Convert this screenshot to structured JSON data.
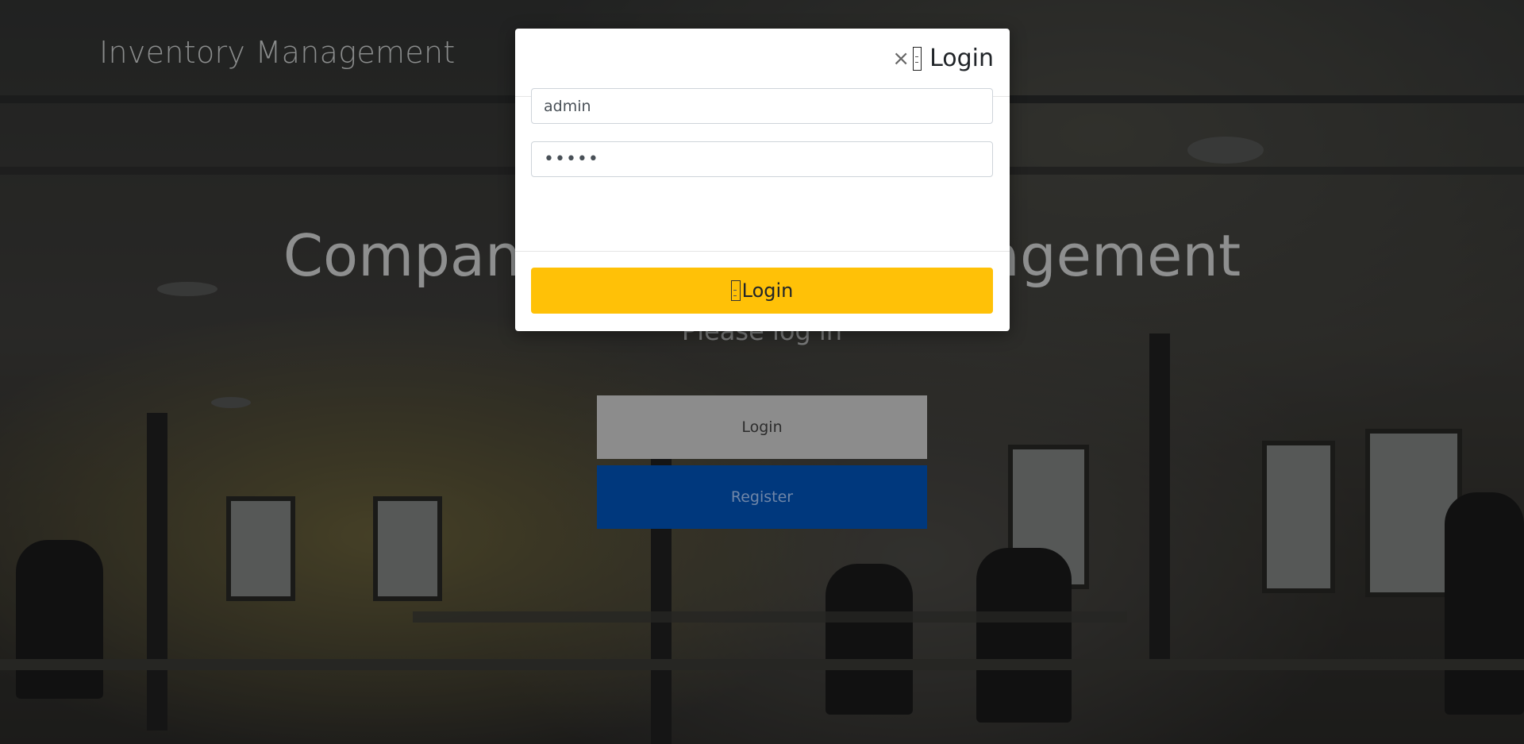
{
  "header": {
    "site_title": "Inventory Management"
  },
  "hero": {
    "title": "Company Inventory Management",
    "subtitle": "Please log in",
    "login_label": "Login",
    "register_label": "Register"
  },
  "login_modal": {
    "close_glyph": "×",
    "title": "Login",
    "username_value": "admin",
    "password_value": "•••••",
    "submit_label": "Login",
    "icon": "sign-in-icon"
  },
  "colors": {
    "submit_button": "#ffc107",
    "hero_login_button": "#8c8c8c",
    "hero_register_button": "#00387d"
  }
}
